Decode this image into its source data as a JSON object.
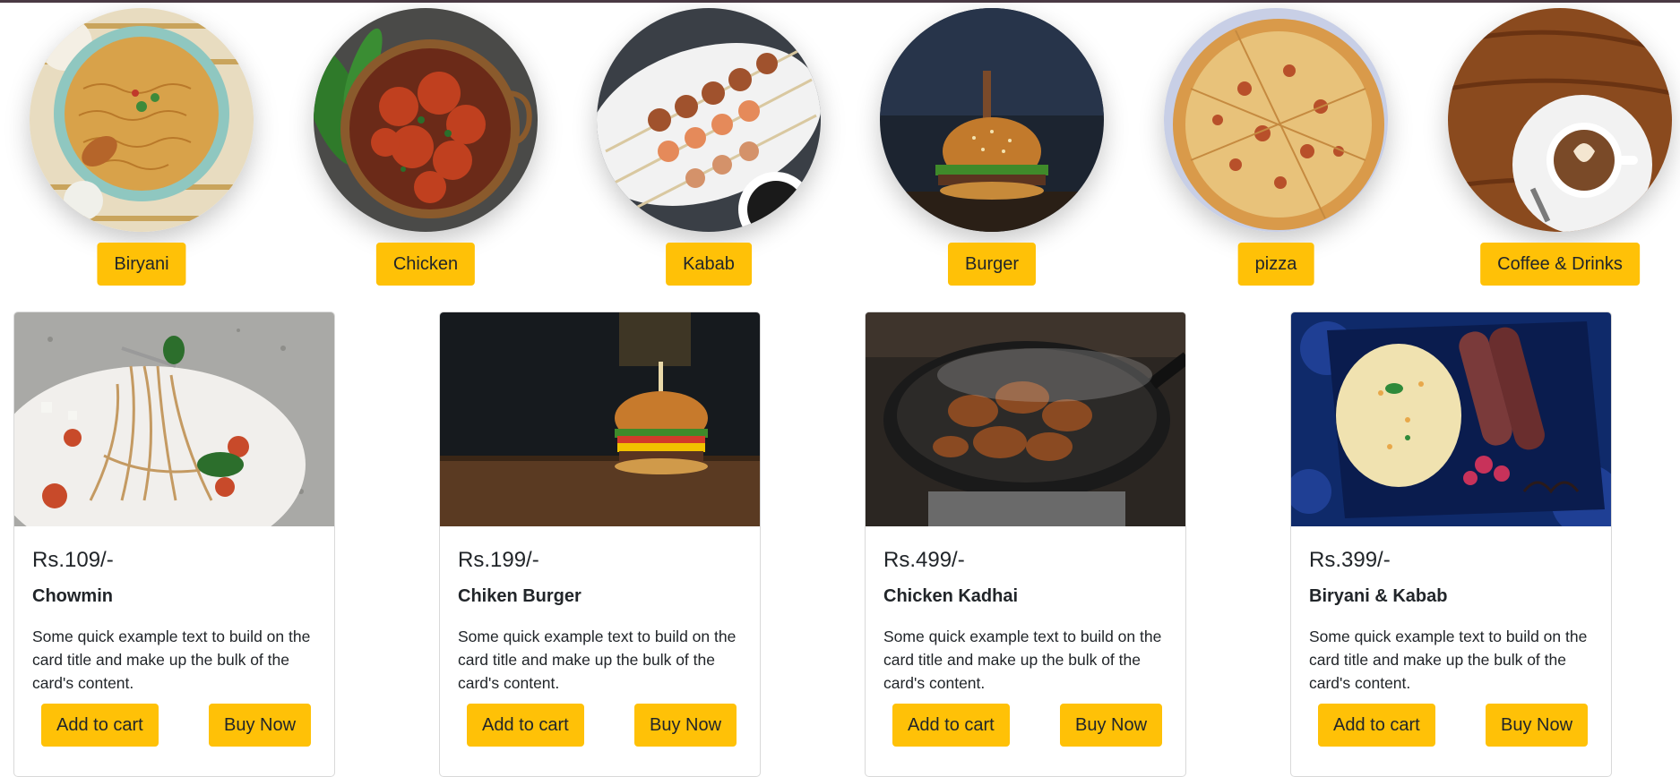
{
  "categories": [
    {
      "label": "Biryani",
      "image": "biryani-bowl-photo"
    },
    {
      "label": "Chicken",
      "image": "chicken-dish-photo"
    },
    {
      "label": "Kabab",
      "image": "kabab-skewers-photo"
    },
    {
      "label": "Burger",
      "image": "burger-photo"
    },
    {
      "label": "pizza",
      "image": "pizza-photo"
    },
    {
      "label": "Coffee & Drinks",
      "image": "coffee-cup-photo"
    }
  ],
  "products": [
    {
      "price": "Rs.109/-",
      "name": "Chowmin",
      "description": "Some quick example text to build on the card title and make up the bulk of the card's content.",
      "add_to_cart": "Add to cart",
      "buy_now": "Buy Now",
      "image": "noodles-fork-photo"
    },
    {
      "price": "Rs.199/-",
      "name": "Chiken Burger",
      "description": "Some quick example text to build on the card title and make up the bulk of the card's content.",
      "add_to_cart": "Add to cart",
      "buy_now": "Buy Now",
      "image": "burger-on-table-photo"
    },
    {
      "price": "Rs.499/-",
      "name": "Chicken Kadhai",
      "description": "Some quick example text to build on the card title and make up the bulk of the card's content.",
      "add_to_cart": "Add to cart",
      "buy_now": "Buy Now",
      "image": "kadhai-pan-photo"
    },
    {
      "price": "Rs.399/-",
      "name": "Biryani & Kabab",
      "description": "Some quick example text to build on the card title and make up the bulk of the card's content.",
      "add_to_cart": "Add to cart",
      "buy_now": "Buy Now",
      "image": "biryani-kabab-plate-photo"
    }
  ],
  "colors": {
    "accent": "#ffc107",
    "text": "#212529",
    "topbar": "#4a3a44"
  }
}
